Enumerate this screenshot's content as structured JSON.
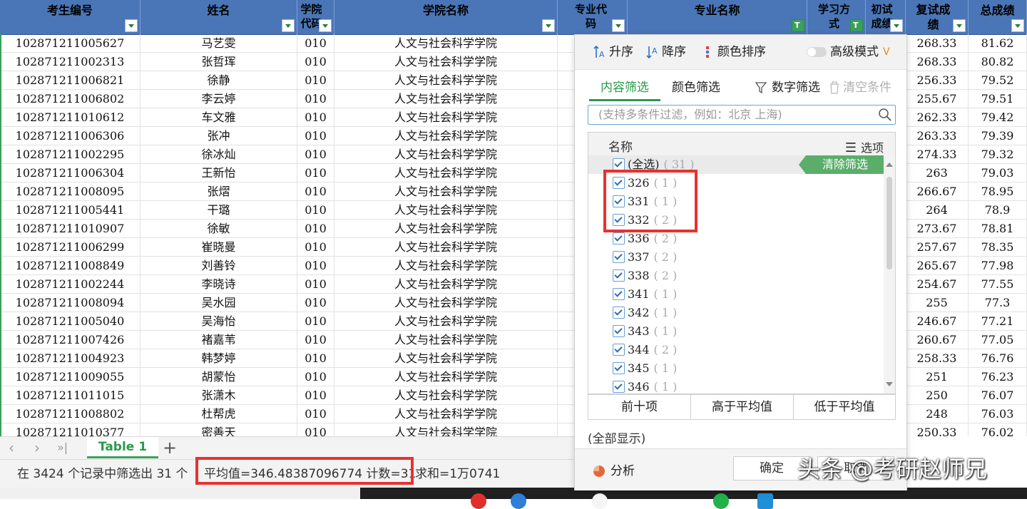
{
  "sheet": {
    "headers": [
      {
        "label": "考生编号",
        "filter": "normal"
      },
      {
        "label": "姓名",
        "filter": "normal"
      },
      {
        "label": "学院代码",
        "filter": "normal"
      },
      {
        "label": "学院名称",
        "filter": "normal"
      },
      {
        "label": "专业代码",
        "filter": "normal"
      },
      {
        "label": "专业名称",
        "filter": "active"
      },
      {
        "label": "学习方式",
        "filter": "active"
      },
      {
        "label": "初试成绩",
        "filter": "normal"
      },
      {
        "label": "复试成绩",
        "filter": "normal"
      },
      {
        "label": "总成绩",
        "filter": "normal"
      }
    ],
    "rows": [
      {
        "id": "102871211005627",
        "name": "马艺雯",
        "code": "010",
        "college": "人文与社会科学学院",
        "retest": "268.33",
        "total": "81.62"
      },
      {
        "id": "102871211002313",
        "name": "张哲珲",
        "code": "010",
        "college": "人文与社会科学学院",
        "retest": "268.33",
        "total": "80.82"
      },
      {
        "id": "102871211006821",
        "name": "徐静",
        "code": "010",
        "college": "人文与社会科学学院",
        "retest": "256.33",
        "total": "79.52"
      },
      {
        "id": "102871211006802",
        "name": "李云婷",
        "code": "010",
        "college": "人文与社会科学学院",
        "retest": "255.67",
        "total": "79.51"
      },
      {
        "id": "102871211010612",
        "name": "车文雅",
        "code": "010",
        "college": "人文与社会科学学院",
        "retest": "262.33",
        "total": "79.42"
      },
      {
        "id": "102871211006306",
        "name": "张冲",
        "code": "010",
        "college": "人文与社会科学学院",
        "retest": "263.33",
        "total": "79.39"
      },
      {
        "id": "102871211002295",
        "name": "徐冰灿",
        "code": "010",
        "college": "人文与社会科学学院",
        "retest": "274.33",
        "total": "79.32"
      },
      {
        "id": "102871211006304",
        "name": "王新怡",
        "code": "010",
        "college": "人文与社会科学学院",
        "retest": "263",
        "total": "79.03"
      },
      {
        "id": "102871211008095",
        "name": "张熠",
        "code": "010",
        "college": "人文与社会科学学院",
        "retest": "266.67",
        "total": "78.95"
      },
      {
        "id": "102871211005441",
        "name": "干璐",
        "code": "010",
        "college": "人文与社会科学学院",
        "retest": "264",
        "total": "78.9"
      },
      {
        "id": "102871211010907",
        "name": "徐敏",
        "code": "010",
        "college": "人文与社会科学学院",
        "retest": "273.67",
        "total": "78.81"
      },
      {
        "id": "102871211006299",
        "name": "崔晓曼",
        "code": "010",
        "college": "人文与社会科学学院",
        "retest": "257.67",
        "total": "78.35"
      },
      {
        "id": "102871211008849",
        "name": "刘善铃",
        "code": "010",
        "college": "人文与社会科学学院",
        "retest": "265.67",
        "total": "77.98"
      },
      {
        "id": "102871211002244",
        "name": "李晓诗",
        "code": "010",
        "college": "人文与社会科学学院",
        "retest": "254.67",
        "total": "77.55"
      },
      {
        "id": "102871211008094",
        "name": "吴水园",
        "code": "010",
        "college": "人文与社会科学学院",
        "retest": "255",
        "total": "77.3"
      },
      {
        "id": "102871211005040",
        "name": "吴海怡",
        "code": "010",
        "college": "人文与社会科学学院",
        "retest": "246.67",
        "total": "77.21"
      },
      {
        "id": "102871211007426",
        "name": "褚嘉苇",
        "code": "010",
        "college": "人文与社会科学学院",
        "retest": "260.67",
        "total": "77.05"
      },
      {
        "id": "102871211004923",
        "name": "韩梦婷",
        "code": "010",
        "college": "人文与社会科学学院",
        "retest": "258.33",
        "total": "76.76"
      },
      {
        "id": "102871211009055",
        "name": "胡蒙怡",
        "code": "010",
        "college": "人文与社会科学学院",
        "retest": "251",
        "total": "76.23"
      },
      {
        "id": "102871211011015",
        "name": "张潇木",
        "code": "010",
        "college": "人文与社会科学学院",
        "retest": "250",
        "total": "76.07"
      },
      {
        "id": "102871211008802",
        "name": "杜帮虎",
        "code": "010",
        "college": "人文与社会科学学院",
        "retest": "248",
        "total": "76.03"
      },
      {
        "id": "102871211010377",
        "name": "密善天",
        "code": "010",
        "college": "人文与社会科学学院",
        "retest": "250.33",
        "total": "76.02"
      }
    ]
  },
  "tabs": {
    "sheet_name": "Table 1",
    "add_label": "+",
    "nav": [
      "‹",
      "›",
      "»|"
    ]
  },
  "status": {
    "filter_info": "在 3424 个记录中筛选出 31 个",
    "average_count": "平均值=346.48387096774  计数=31",
    "sum": "求和=1万0741"
  },
  "filter_panel": {
    "toolbar": {
      "asc": "升序",
      "desc": "降序",
      "color_sort": "颜色排序",
      "advanced": "高级模式",
      "advanced_badge": "V"
    },
    "tabs": {
      "content": "内容筛选",
      "color": "颜色筛选",
      "number": "数字筛选",
      "clear": "清空条件"
    },
    "search_placeholder": "(支持多条件过滤，例如：北京 上海)",
    "list_header": {
      "name": "名称",
      "options": "选项"
    },
    "select_all": {
      "label": "(全选)",
      "count": "( 31 )"
    },
    "clear_filter": "清除筛选",
    "items": [
      {
        "label": "326",
        "count": "( 1 )"
      },
      {
        "label": "331",
        "count": "( 1 )"
      },
      {
        "label": "332",
        "count": "( 2 )"
      },
      {
        "label": "336",
        "count": "( 2 )"
      },
      {
        "label": "337",
        "count": "( 2 )"
      },
      {
        "label": "338",
        "count": "( 2 )"
      },
      {
        "label": "341",
        "count": "( 1 )"
      },
      {
        "label": "342",
        "count": "( 1 )"
      },
      {
        "label": "343",
        "count": "( 1 )"
      },
      {
        "label": "344",
        "count": "( 2 )"
      },
      {
        "label": "345",
        "count": "( 1 )"
      },
      {
        "label": "346",
        "count": "( 1 )"
      }
    ],
    "quick": {
      "top10": "前十项",
      "above_avg": "高于平均值",
      "below_avg": "低于平均值"
    },
    "show_all": "(全部显示)",
    "analyze": "分析",
    "ok": "确定",
    "cancel": "取消"
  },
  "watermark": "头条 @考研赵师兄",
  "colors": {
    "header": "#4a76b8",
    "accent_green": "#2a9a4a",
    "highlight_red": "#e8322f"
  }
}
